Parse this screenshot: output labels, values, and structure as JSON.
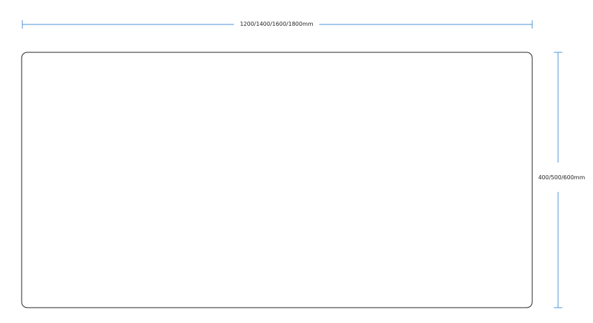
{
  "dimensions": {
    "width_label": "1200/1400/1600/1800mm",
    "height_label": "400/500/600mm"
  },
  "colors": {
    "dimension_line": "#4a90d9",
    "outline": "#222222",
    "text": "#222222"
  }
}
